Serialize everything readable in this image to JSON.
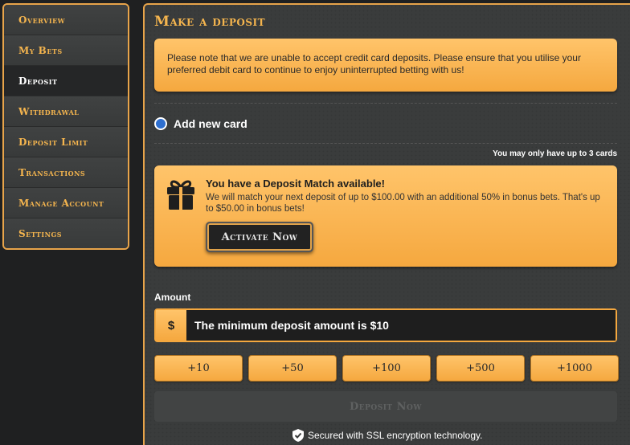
{
  "sidebar": {
    "items": [
      {
        "label": "Overview"
      },
      {
        "label": "My Bets"
      },
      {
        "label": "Deposit"
      },
      {
        "label": "Withdrawal"
      },
      {
        "label": "Deposit Limit"
      },
      {
        "label": "Transactions"
      },
      {
        "label": "Manage Account"
      },
      {
        "label": "Settings"
      }
    ],
    "active": "Deposit"
  },
  "main": {
    "title": "Make a deposit",
    "notice": "Please note that we are unable to accept credit card deposits. Please ensure that you utilise your preferred debit card to continue to enjoy uninterrupted betting with us!",
    "add_card_label": "Add new card",
    "card_limit": "You may only have up to 3 cards",
    "match": {
      "icon": "gift-icon",
      "title": "You have a Deposit Match available!",
      "text": "We will match your next deposit of up to $100.00 with an additional 50% in bonus bets. That's up to $50.00 in bonus bets!",
      "button": "Activate Now"
    },
    "amount": {
      "label": "Amount",
      "currency": "$",
      "placeholder": "The minimum deposit amount is $10"
    },
    "quick_amounts": [
      "+10",
      "+50",
      "+100",
      "+500",
      "+1000"
    ],
    "deposit_button": "Deposit Now",
    "ssl_text": "Secured with SSL encryption technology.",
    "ssl_icon": "shield-check-icon"
  },
  "colors": {
    "accent": "#f5a83f",
    "accent_text": "#f5b54e",
    "panel": "#3a3c3c",
    "background": "#1f2021"
  }
}
